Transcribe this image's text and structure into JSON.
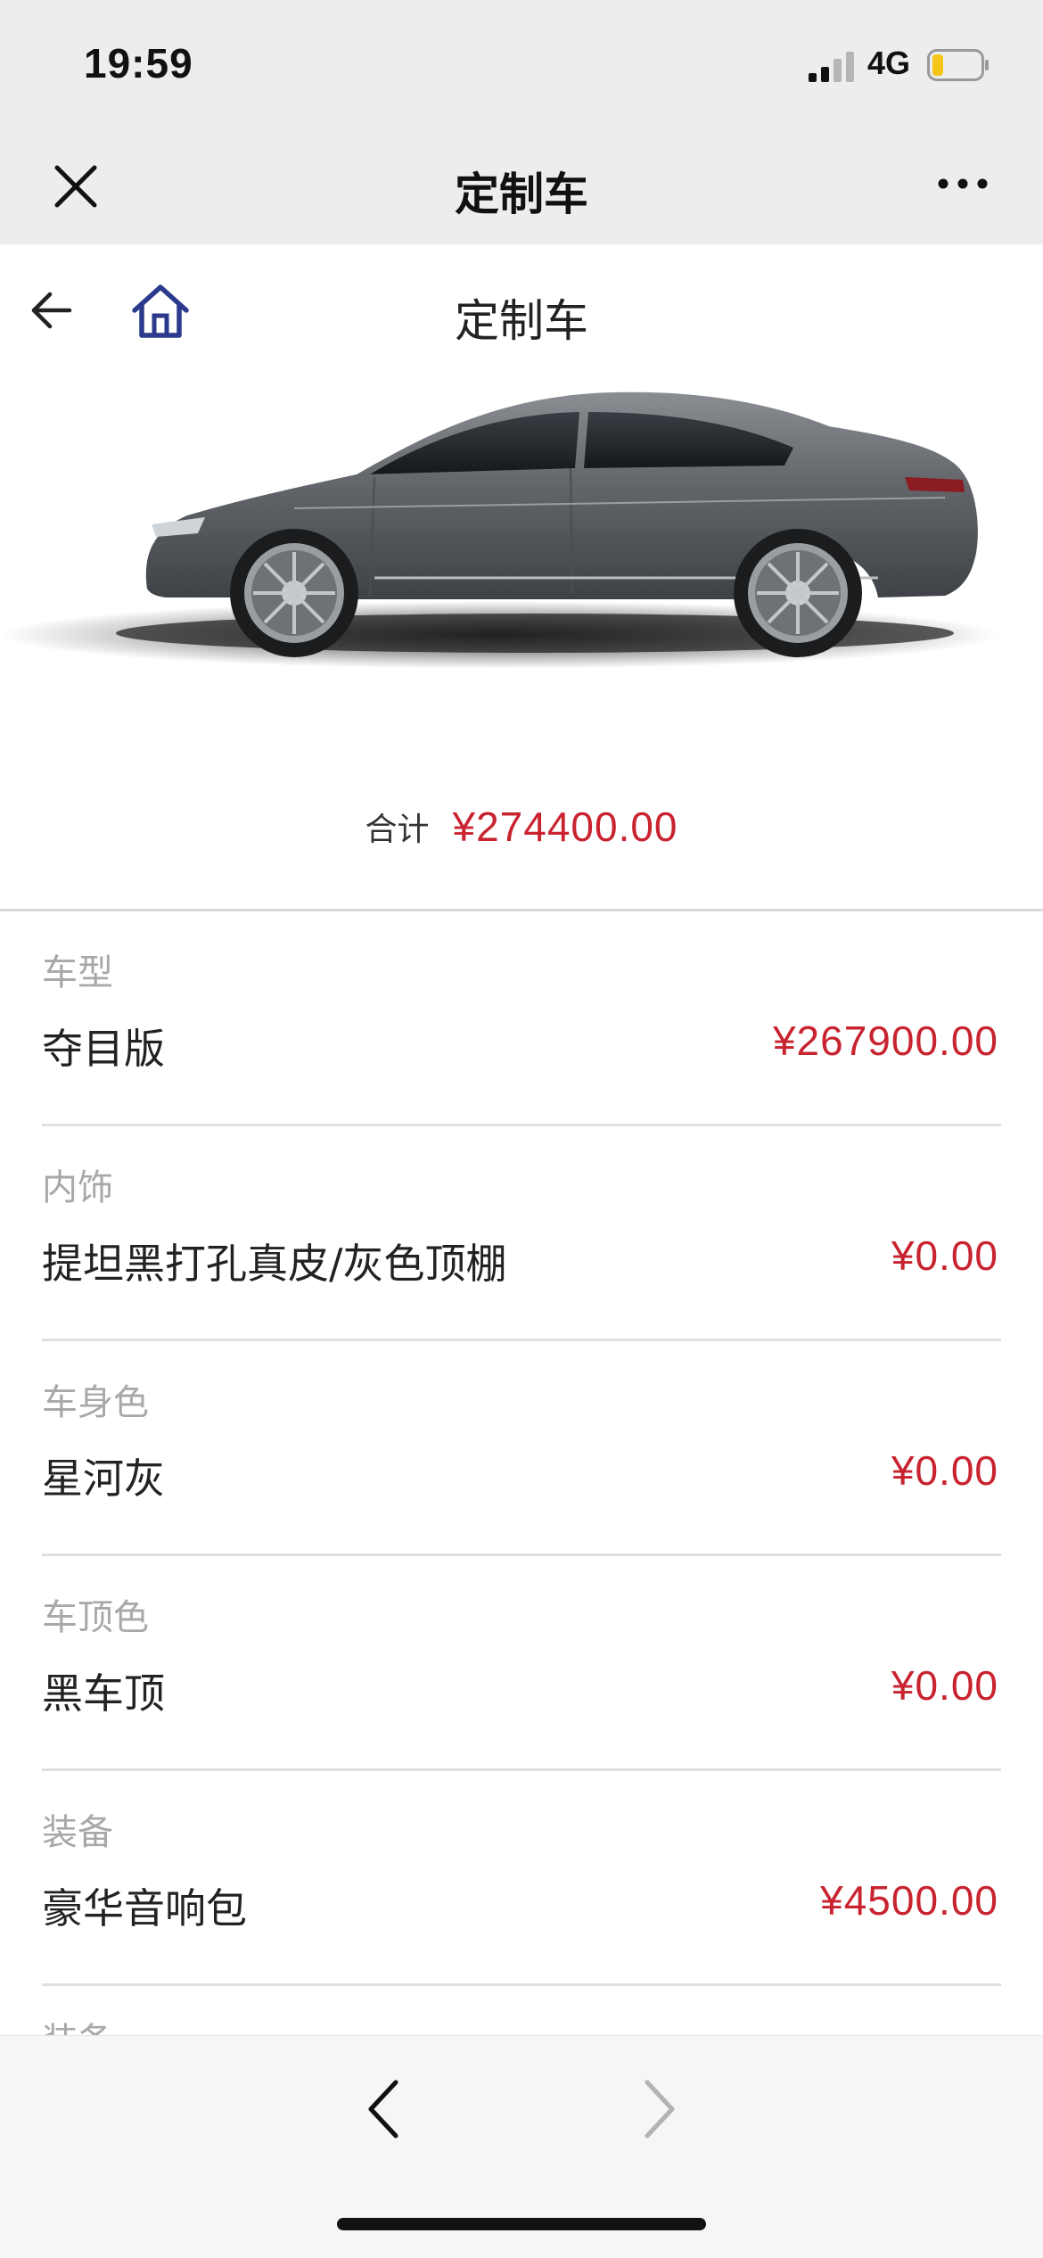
{
  "status_bar": {
    "time": "19:59",
    "network": "4G",
    "signal_icon": "signal-icon",
    "battery_icon": "battery-low-icon"
  },
  "nav": {
    "title": "定制车",
    "close_icon": "close-icon",
    "more_icon": "more-icon"
  },
  "header": {
    "title": "定制车",
    "back_icon": "arrow-left-icon",
    "home_icon": "home-icon",
    "home_color": "#2b3a8c"
  },
  "total": {
    "label": "合计",
    "value": "¥274400.00"
  },
  "config_items": [
    {
      "category": "车型",
      "name": "夺目版",
      "price": "¥267900.00"
    },
    {
      "category": "内饰",
      "name": "提坦黑打孔真皮/灰色顶棚",
      "price": "¥0.00"
    },
    {
      "category": "车身色",
      "name": "星河灰",
      "price": "¥0.00"
    },
    {
      "category": "车顶色",
      "name": "黑车顶",
      "price": "¥0.00"
    },
    {
      "category": "装备",
      "name": "豪华音响包",
      "price": "¥4500.00"
    }
  ],
  "partial_item_category": "装备",
  "toolbar": {
    "prev_icon": "chevron-left-icon",
    "next_icon": "chevron-right-icon"
  },
  "colors": {
    "price_red": "#c8232f",
    "nav_background": "#ededed",
    "car_color": "#5d6166"
  }
}
